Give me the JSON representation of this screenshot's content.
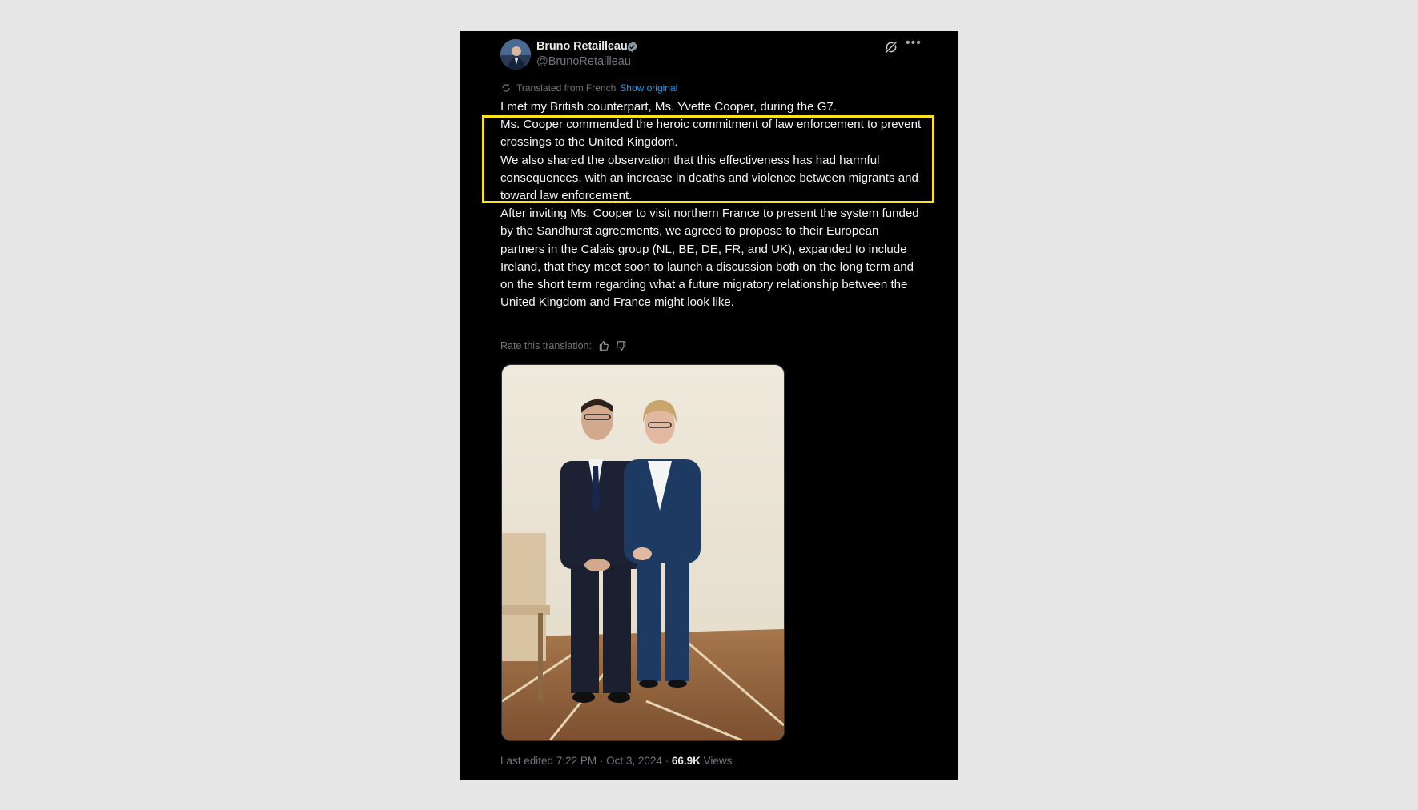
{
  "author": {
    "name": "Bruno Retailleau",
    "handle": "@BrunoRetailleau",
    "verified": true
  },
  "translation": {
    "notice": "Translated from French",
    "show_original": "Show original",
    "rate_label": "Rate this translation:"
  },
  "tweet": {
    "paragraphs": [
      "I met my British counterpart, Ms. Yvette Cooper, during the G7.",
      "Ms. Cooper commended the heroic commitment of law enforcement to prevent crossings to the United Kingdom.",
      "We also shared the observation that this effectiveness has had harmful consequences, with an increase in deaths and violence between migrants and toward law enforcement.",
      "After inviting Ms. Cooper to visit northern France to present the system funded by the Sandhurst agreements, we agreed to propose to their European partners in the Calais group (NL, BE, DE, FR, and UK), expanded to include Ireland, that they meet soon to launch a discussion both on the long term and on the short term regarding what a future migratory relationship between the United Kingdom and France might look like."
    ]
  },
  "footer": {
    "edited": "Last edited 7:22 PM · Oct 3, 2024 · ",
    "views_count": "66.9K",
    "views_label": " Views"
  },
  "icons": {
    "grok": "grok-icon",
    "more": "more-options-icon",
    "translate": "translate-icon",
    "thumbs_up": "thumbs-up-icon",
    "thumbs_down": "thumbs-down-icon",
    "verified": "verified-badge-icon"
  },
  "colors": {
    "background": "#e6e6e6",
    "card": "#000000",
    "text": "#e7e9ea",
    "muted": "#71767b",
    "link": "#1d9bf0",
    "highlight": "#ffe31a"
  }
}
